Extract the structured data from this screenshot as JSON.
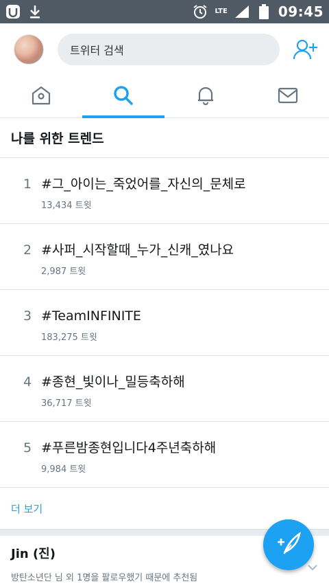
{
  "status_bar": {
    "time": "09:45",
    "network": "LTE",
    "icons": [
      "app-icon",
      "download-icon",
      "alarm-icon",
      "signal-icon",
      "battery-icon"
    ]
  },
  "header": {
    "search_placeholder": "트위터 검색",
    "avatar_icon": "avatar",
    "add_user_icon": "add-user-icon"
  },
  "tabs": [
    {
      "name": "home",
      "icon": "home-icon",
      "active": false
    },
    {
      "name": "search",
      "icon": "search-icon",
      "active": true
    },
    {
      "name": "notifications",
      "icon": "bell-icon",
      "active": false
    },
    {
      "name": "messages",
      "icon": "mail-icon",
      "active": false
    }
  ],
  "trends": {
    "title": "나를 위한 트렌드",
    "items": [
      {
        "rank": "1",
        "name": "#그_아이는_죽었어를_자신의_문체로",
        "count": "13,434 트윗"
      },
      {
        "rank": "2",
        "name": "#사퍼_시작할때_누가_신캐_였나요",
        "count": "2,987 트윗"
      },
      {
        "rank": "3",
        "name": "#TeamINFINITE",
        "count": "183,275 트윗"
      },
      {
        "rank": "4",
        "name": "#종현_빛이나_밀등축하해",
        "count": "36,717 트윗"
      },
      {
        "rank": "5",
        "name": "#푸른밤종현입니다4주년축하해",
        "count": "9,984 트윗"
      }
    ],
    "more_label": "더 보기"
  },
  "suggestion": {
    "name": "Jin (진)",
    "reason": "방탄소년단 님 외 1명을 팔로우했기 때문에 추천됨"
  },
  "colors": {
    "accent": "#1da1f2",
    "status_bar": "#4f5a65",
    "text_primary": "#14171a",
    "text_secondary": "#66757f"
  }
}
